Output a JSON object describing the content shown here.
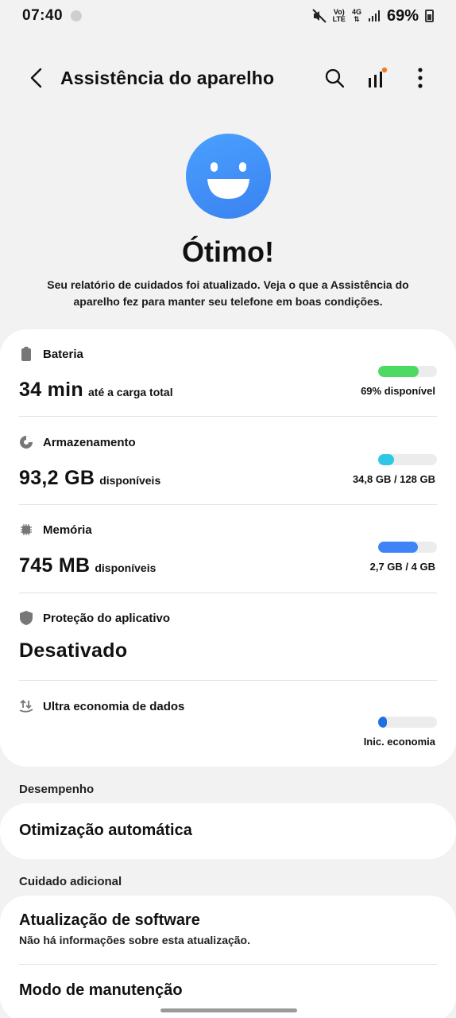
{
  "status_bar": {
    "time": "07:40",
    "network_label_1": "Vo)",
    "network_label_2": "LTE",
    "network_4g": "4G",
    "battery_percent": "69%"
  },
  "header": {
    "title": "Assistência do aparelho"
  },
  "hero": {
    "title": "Ótimo!",
    "description": "Seu relatório de cuidados foi atualizado. Veja o que a Assistência do aparelho fez para manter seu telefone em boas condições."
  },
  "items": {
    "battery": {
      "label": "Bateria",
      "value": "34 min",
      "suffix": "até a carga total",
      "bar_text": "69% disponível",
      "fill_fraction": 0.69,
      "color": "#4cd964"
    },
    "storage": {
      "label": "Armazenamento",
      "value": "93,2 GB",
      "suffix": "disponíveis",
      "bar_text": "34,8 GB / 128 GB",
      "fill_fraction": 0.27,
      "color": "#2ec8e6"
    },
    "memory": {
      "label": "Memória",
      "value": "745 MB",
      "suffix": "disponíveis",
      "bar_text": "2,7 GB / 4 GB",
      "fill_fraction": 0.68,
      "color": "#3f83f8"
    },
    "app_protection": {
      "label": "Proteção do aplicativo",
      "value": "Desativado"
    },
    "data_saver": {
      "label": "Ultra economia de dados",
      "bar_text": "Inic. economia",
      "fill_fraction": 0.1,
      "color": "#1e6fe0"
    }
  },
  "performance": {
    "section_label": "Desempenho",
    "auto_optimization": "Otimização automática"
  },
  "additional_care": {
    "section_label": "Cuidado adicional",
    "software_update_title": "Atualização de software",
    "software_update_sub": "Não há informações sobre esta atualização.",
    "maintenance_mode": "Modo de manutenção"
  }
}
